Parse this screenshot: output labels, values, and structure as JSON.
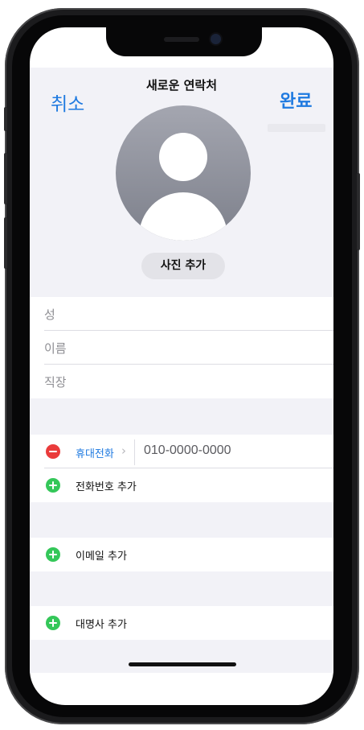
{
  "header": {
    "cancel_label": "취소",
    "title": "새로운 연락처",
    "done_label": "완료"
  },
  "photo": {
    "add_photo_label": "사진 추가"
  },
  "name_fields": [
    {
      "placeholder": "성"
    },
    {
      "placeholder": "이름"
    },
    {
      "placeholder": "직장"
    }
  ],
  "phone": {
    "type_label": "휴대전화",
    "chevron": "›",
    "value": "010-0000-0000",
    "add_label": "전화번호 추가"
  },
  "email": {
    "add_label": "이메일 추가"
  },
  "card": {
    "add_label": "대명사 추가"
  },
  "colors": {
    "accent": "#1f7ae0",
    "delete": "#ea3b3b",
    "add": "#34c759",
    "background": "#f2f2f7"
  }
}
